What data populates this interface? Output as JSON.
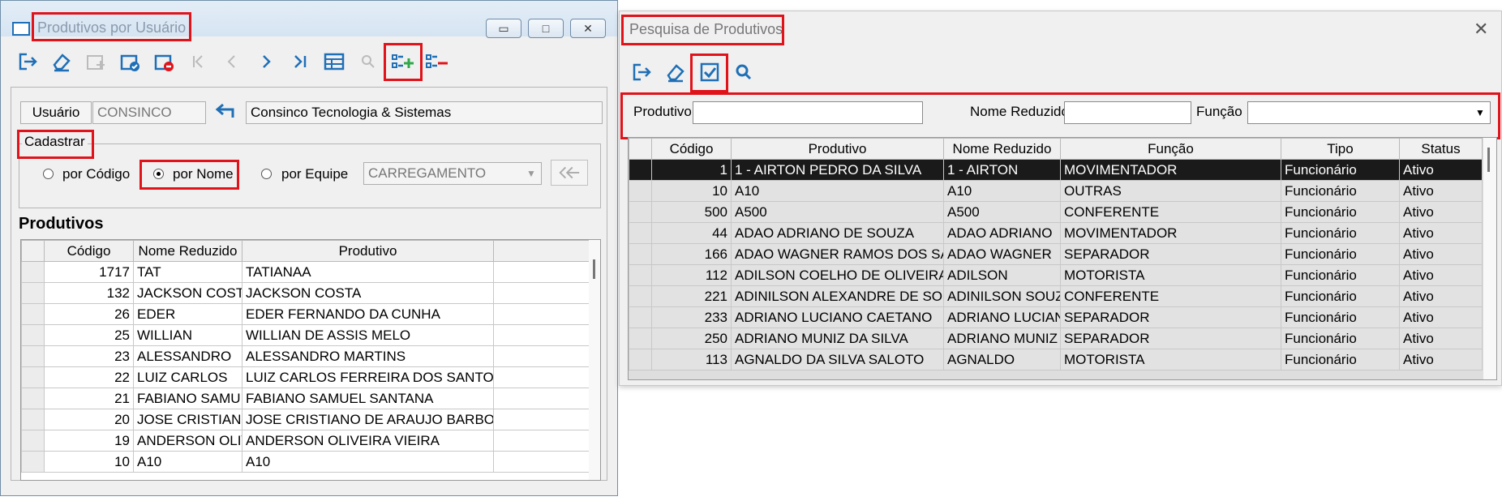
{
  "win1": {
    "title": "Produtivos por Usuário",
    "caption_buttons": [
      "▭",
      "□",
      "✕"
    ],
    "toolbar": [
      "exit-icon",
      "eraser-icon",
      "new-doc-icon",
      "doc-check-icon",
      "doc-delete-icon",
      "first-icon",
      "previous-icon",
      "next-icon",
      "last-icon",
      "grid-icon",
      "search-icon",
      "list-add-icon",
      "list-remove-icon"
    ],
    "usuario_label": "Usuário",
    "usuario_value": "CONSINCO",
    "empresa_value": "Consinco Tecnologia & Sistemas",
    "cadastrar_label": "Cadastrar",
    "radio_codigo": "por Código",
    "radio_nome": "por Nome",
    "radio_equipe": "por Equipe",
    "equipe_value": "CARREGAMENTO",
    "produtivos_label": "Produtivos",
    "columns": [
      "Código",
      "Nome Reduzido",
      "Produtivo"
    ],
    "rows": [
      [
        "1717",
        "TAT",
        "TATIANAA"
      ],
      [
        "132",
        "JACKSON COST/",
        "JACKSON COSTA"
      ],
      [
        "26",
        "EDER",
        "EDER FERNANDO DA CUNHA"
      ],
      [
        "25",
        "WILLIAN",
        "WILLIAN DE ASSIS MELO"
      ],
      [
        "23",
        "ALESSANDRO",
        "ALESSANDRO MARTINS"
      ],
      [
        "22",
        "LUIZ CARLOS",
        "LUIZ CARLOS FERREIRA DOS SANTOS"
      ],
      [
        "21",
        "FABIANO SAMUI",
        "FABIANO SAMUEL SANTANA"
      ],
      [
        "20",
        "JOSE CRISTIAN(",
        "JOSE CRISTIANO DE ARAUJO BARBOS."
      ],
      [
        "19",
        "ANDERSON OLI\\",
        "ANDERSON OLIVEIRA VIEIRA"
      ],
      [
        "10",
        "A10",
        "A10"
      ]
    ]
  },
  "win2": {
    "title": "Pesquisa de Produtivos",
    "close_glyph": "✕",
    "toolbar": [
      "exit-icon",
      "eraser-icon",
      "checkbox-icon",
      "search-icon"
    ],
    "filter_produtivo": "Produtivo",
    "filter_nome_reduzido": "Nome Reduzido",
    "filter_funcao": "Função",
    "columns": [
      "Código",
      "Produtivo",
      "Nome Reduzido",
      "Função",
      "Tipo",
      "Status"
    ],
    "rows": [
      [
        "1",
        "1 - AIRTON PEDRO DA SILVA",
        "1 - AIRTON",
        "MOVIMENTADOR",
        "Funcionário",
        "Ativo"
      ],
      [
        "10",
        "A10",
        "A10",
        "OUTRAS",
        "Funcionário",
        "Ativo"
      ],
      [
        "500",
        "A500",
        "A500",
        "CONFERENTE",
        "Funcionário",
        "Ativo"
      ],
      [
        "44",
        "ADAO ADRIANO DE SOUZA",
        "ADAO ADRIANO",
        "MOVIMENTADOR",
        "Funcionário",
        "Ativo"
      ],
      [
        "166",
        "ADAO WAGNER RAMOS DOS SA",
        "ADAO WAGNER",
        "SEPARADOR",
        "Funcionário",
        "Ativo"
      ],
      [
        "112",
        "ADILSON COELHO DE OLIVEIRA",
        "ADILSON",
        "MOTORISTA",
        "Funcionário",
        "Ativo"
      ],
      [
        "221",
        "ADINILSON ALEXANDRE DE SOL",
        "ADINILSON SOUZ",
        "CONFERENTE",
        "Funcionário",
        "Ativo"
      ],
      [
        "233",
        "ADRIANO LUCIANO CAETANO",
        "ADRIANO LUCIAN",
        "SEPARADOR",
        "Funcionário",
        "Ativo"
      ],
      [
        "250",
        "ADRIANO MUNIZ DA SILVA",
        "ADRIANO MUNIZ",
        "SEPARADOR",
        "Funcionário",
        "Ativo"
      ],
      [
        "113",
        "AGNALDO DA SILVA SALOTO",
        "AGNALDO",
        "MOTORISTA",
        "Funcionário",
        "Ativo"
      ]
    ]
  },
  "colors": {
    "highlight": "#e0131a",
    "selected_row": "#1a1a1a"
  }
}
